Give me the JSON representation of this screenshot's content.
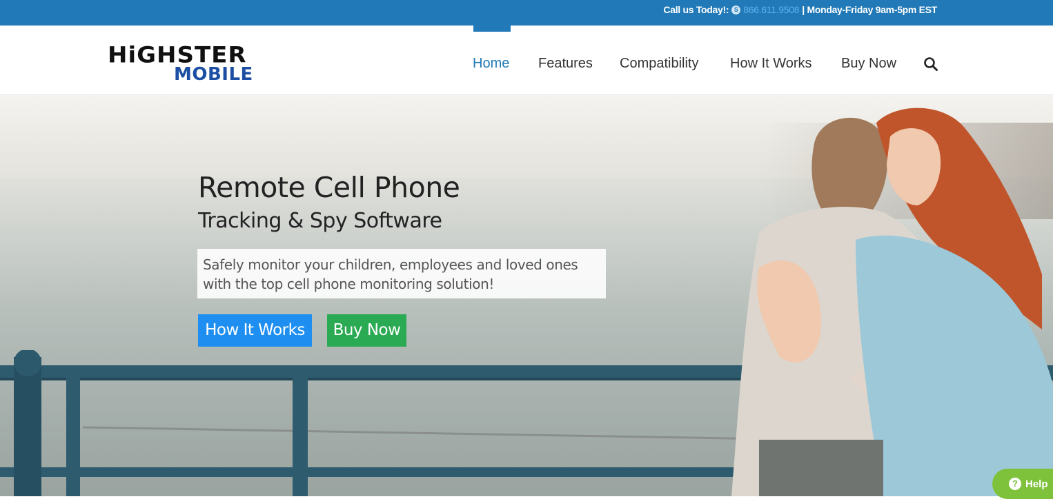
{
  "topbar": {
    "call_label": "Call us Today!:",
    "skype_icon": "S",
    "phone": "866.611.9508",
    "hours": "| Monday-Friday 9am-5pm EST"
  },
  "logo": {
    "line1": "HiGHSTER",
    "line2": "MOBILE"
  },
  "nav": {
    "items": [
      {
        "label": "Home",
        "active": true
      },
      {
        "label": "Features"
      },
      {
        "label": "Compatibility"
      },
      {
        "label": "How It Works"
      },
      {
        "label": "Buy Now"
      }
    ],
    "search_icon": "search-icon"
  },
  "hero": {
    "headline": "Remote Cell Phone",
    "subheadline": "Tracking & Spy Software",
    "tagline_line1": "Safely monitor your children, employees and loved ones",
    "tagline_line2": "with the top cell phone monitoring solution!",
    "btn_how": "How It Works",
    "btn_buy": "Buy Now"
  },
  "help_widget": {
    "icon": "?",
    "label": "Help"
  },
  "colors": {
    "brand_blue": "#2179b7",
    "button_blue": "#1e8ff0",
    "button_green": "#2aaa52",
    "help_green": "#7ec23c"
  }
}
